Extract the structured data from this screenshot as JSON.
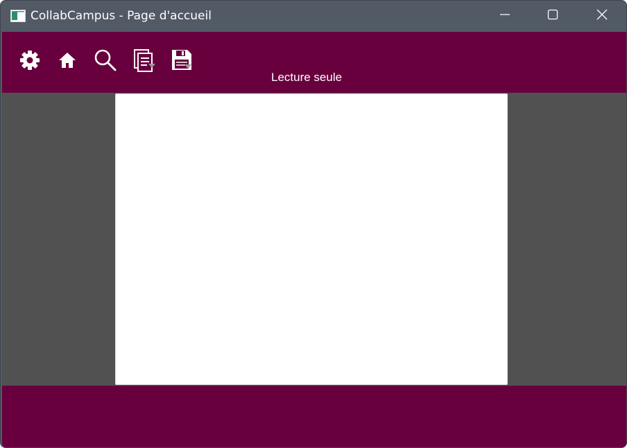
{
  "window": {
    "title": "CollabCampus - Page d'accueil",
    "controls": {
      "minimize": "minimize-icon",
      "maximize": "maximize-icon",
      "close": "close-icon"
    }
  },
  "toolbar": {
    "icons": [
      "gear-icon",
      "home-icon",
      "search-icon",
      "document-icon",
      "save-icon"
    ],
    "mode_label": "Lecture seule"
  },
  "colors": {
    "titlebar": "#525a66",
    "toolbar": "#68003e",
    "content_bg": "#515151",
    "page": "#ffffff",
    "footer": "#68003e"
  }
}
